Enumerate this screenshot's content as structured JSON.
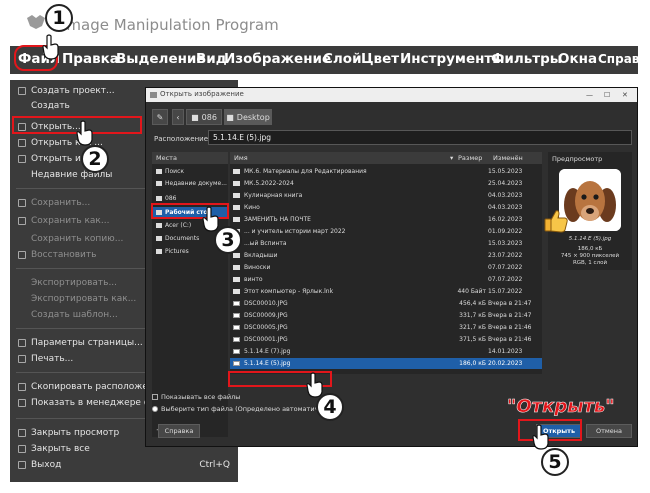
{
  "window": {
    "title": "Image Manipulation Program"
  },
  "menubar": {
    "items": [
      {
        "label": "Файл"
      },
      {
        "label": "Правка"
      },
      {
        "label": "Выделение"
      },
      {
        "label": "Вид"
      },
      {
        "label": "Изображение"
      },
      {
        "label": "Слой"
      },
      {
        "label": "Цвет"
      },
      {
        "label": "Инструменты"
      },
      {
        "label": "Фильтры"
      },
      {
        "label": "Окна"
      },
      {
        "label": "Справка"
      }
    ]
  },
  "file_menu": {
    "items": [
      {
        "label": "Создать проект...",
        "icon": "new-project-icon",
        "enabled": true
      },
      {
        "label": "Создать",
        "icon": "",
        "enabled": true
      },
      {
        "label": "Открыть...",
        "icon": "open-icon",
        "enabled": true
      },
      {
        "label": "Открыть как ...",
        "icon": "open-as-icon",
        "enabled": true
      },
      {
        "label": "Открыть из ...",
        "icon": "open-location-icon",
        "enabled": true
      },
      {
        "label": "Недавние файлы",
        "icon": "",
        "enabled": true
      },
      {
        "label": "Сохранить...",
        "icon": "save-icon",
        "enabled": false
      },
      {
        "label": "Сохранить как...",
        "icon": "save-as-icon",
        "enabled": false
      },
      {
        "label": "Сохранить копию...",
        "icon": "",
        "enabled": false
      },
      {
        "label": "Восстановить",
        "icon": "revert-icon",
        "enabled": false
      },
      {
        "label": "Экспортировать...",
        "icon": "",
        "enabled": false
      },
      {
        "label": "Экспортировать как...",
        "icon": "",
        "enabled": false
      },
      {
        "label": "Создать шаблон...",
        "icon": "",
        "enabled": false
      },
      {
        "label": "Параметры страницы...",
        "icon": "page-setup-icon",
        "enabled": true
      },
      {
        "label": "Печать...",
        "icon": "print-icon",
        "enabled": true
      },
      {
        "label": "Скопировать расположение",
        "icon": "copy-location-icon",
        "enabled": true
      },
      {
        "label": "Показать в менеджере файлов",
        "icon": "file-manager-icon",
        "enabled": true
      },
      {
        "label": "Закрыть просмотр",
        "icon": "close-view-icon",
        "enabled": true
      },
      {
        "label": "Закрыть все",
        "icon": "close-all-icon",
        "enabled": true
      },
      {
        "label": "Выход",
        "icon": "quit-icon",
        "enabled": true
      }
    ],
    "quit_shortcut": "Ctrl+Q"
  },
  "dialog": {
    "title": "Открыть изображение",
    "path": [
      "086",
      "Desktop"
    ],
    "location_label": "Расположение:",
    "location_value": "5.1.14.Е (5).jpg",
    "places_header": "Места",
    "places": [
      "Поиск",
      "Недавние докуме...",
      "086",
      "Рабочий стол",
      "Acer (C:)",
      "Documents",
      "Pictures"
    ],
    "columns": {
      "name": "Имя",
      "size": "Размер",
      "modified": "Изменён"
    },
    "files": [
      {
        "name": "МК.6. Материалы для Редактирования",
        "size": "",
        "date": "15.05.2023",
        "type": "folder"
      },
      {
        "name": "МК.5.2022-2024",
        "size": "",
        "date": "25.04.2023",
        "type": "folder"
      },
      {
        "name": "Кулинарная книга",
        "size": "",
        "date": "04.03.2023",
        "type": "folder"
      },
      {
        "name": "Кино",
        "size": "",
        "date": "04.03.2023",
        "type": "folder"
      },
      {
        "name": "ЗАМЕНИТЬ НА ПОЧТЕ",
        "size": "",
        "date": "16.02.2023",
        "type": "folder"
      },
      {
        "name": "... и учитель истории март 2022",
        "size": "",
        "date": "01.09.2022",
        "type": "folder"
      },
      {
        "name": "...ый Вспинта",
        "size": "",
        "date": "15.03.2023",
        "type": "folder"
      },
      {
        "name": "Вкладыши",
        "size": "",
        "date": "23.07.2022",
        "type": "folder"
      },
      {
        "name": "Виноски",
        "size": "",
        "date": "07.07.2022",
        "type": "folder"
      },
      {
        "name": "винто",
        "size": "",
        "date": "07.07.2022",
        "type": "folder"
      },
      {
        "name": "Этот компьютер - Ярлык.lnk",
        "size": "440 Байт",
        "date": "15.07.2022",
        "type": "file"
      },
      {
        "name": "DSC00010.JPG",
        "size": "456,4 кБ",
        "date": "Вчера в 21:47",
        "type": "image"
      },
      {
        "name": "DSC00009.JPG",
        "size": "331,7 кБ",
        "date": "Вчера в 21:47",
        "type": "image"
      },
      {
        "name": "DSC00005.JPG",
        "size": "321,7 кБ",
        "date": "Вчера в 21:46",
        "type": "image"
      },
      {
        "name": "DSC00001.JPG",
        "size": "371,5 кБ",
        "date": "Вчера в 21:46",
        "type": "image"
      },
      {
        "name": "5.1.14.Е (7).jpg",
        "size": "",
        "date": "14.01.2023",
        "type": "image"
      },
      {
        "name": "5.1.14.Е (5).jpg",
        "size": "186,0 кБ",
        "date": "20.02.2023",
        "type": "image",
        "selected": true
      }
    ],
    "preview": {
      "header": "Предпросмотр",
      "name": "5.1.14.Е (5).jpg",
      "size": "186,0 кБ",
      "dimensions": "745 × 900 пикселей",
      "mode": "RGB, 1 слой"
    },
    "show_all_files": "Показывать все файлы",
    "file_type": "Выберите тип файла (Определено автоматич...",
    "help_label": "Справка",
    "open_label": "Открыть",
    "cancel_label": "Отмена"
  },
  "annotations": {
    "steps": [
      "1",
      "2",
      "3",
      "4",
      "5"
    ],
    "callout": "\"Открыть\"",
    "accent": "#e2161b"
  }
}
